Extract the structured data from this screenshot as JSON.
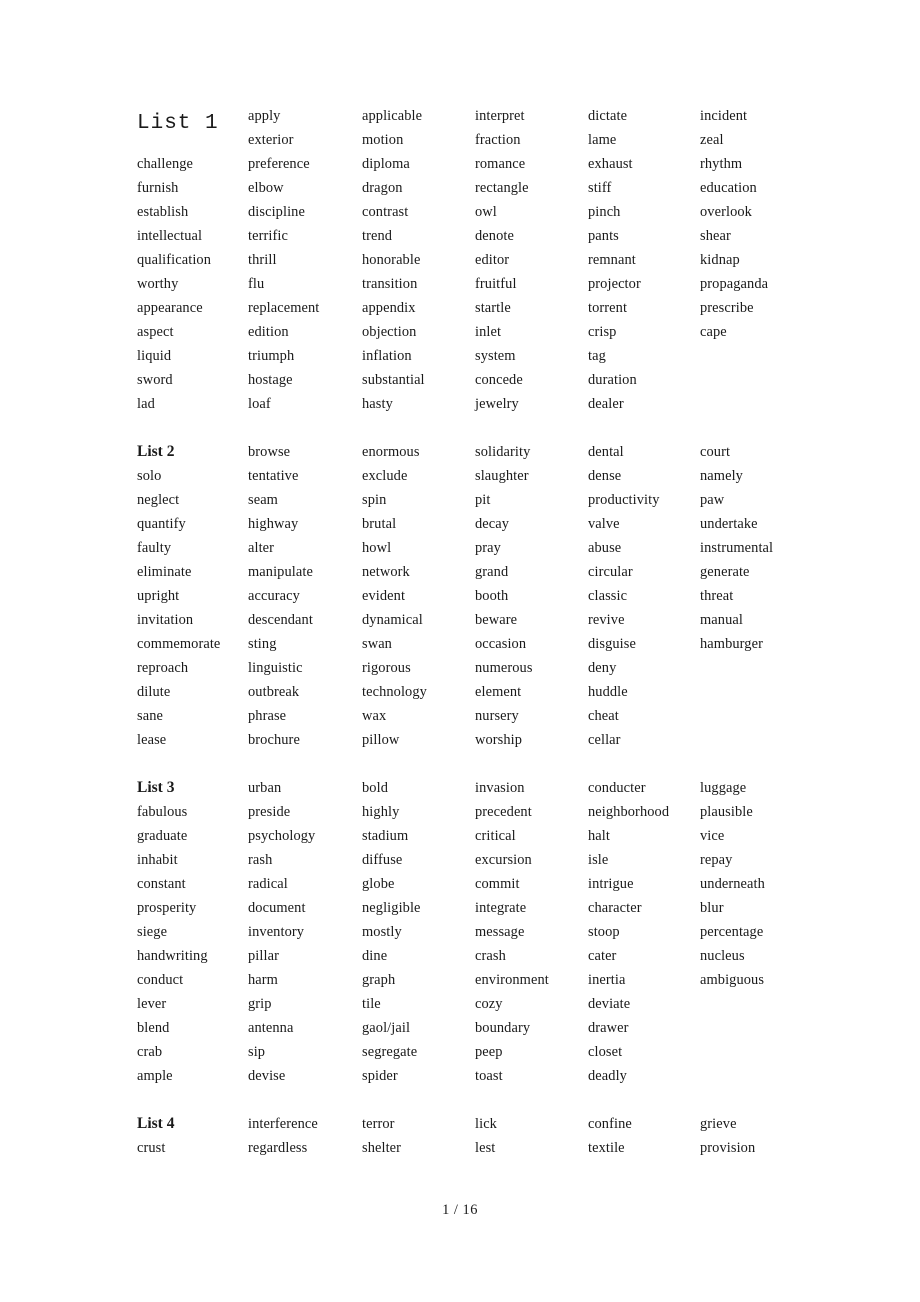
{
  "document": {
    "footer": {
      "page_number": "1",
      "separator": "/",
      "total_pages": "16",
      "text": "1  / 16"
    }
  },
  "lists": [
    {
      "title": "List 1",
      "title_style": "mono",
      "columns": [
        [
          "challenge",
          "furnish",
          "establish",
          "intellectual",
          "qualification",
          "worthy",
          "appearance",
          "aspect",
          "liquid",
          "sword",
          "lad"
        ],
        [
          "apply",
          "exterior",
          "preference",
          "elbow",
          "discipline",
          "terrific",
          "thrill",
          "flu",
          "replacement",
          "edition",
          "triumph",
          "hostage",
          "loaf"
        ],
        [
          "applicable",
          "motion",
          "diploma",
          "dragon",
          "contrast",
          "trend",
          "honorable",
          "transition",
          "appendix",
          "objection",
          "inflation",
          "substantial",
          "hasty"
        ],
        [
          "interpret",
          "fraction",
          "romance",
          "rectangle",
          "owl",
          "denote",
          "editor",
          "fruitful",
          "startle",
          "inlet",
          "system",
          "concede",
          "jewelry"
        ],
        [
          "dictate",
          "lame",
          "exhaust",
          "stiff",
          "pinch",
          "pants",
          "remnant",
          "projector",
          "torrent",
          "crisp",
          "tag",
          "duration",
          "dealer"
        ],
        [
          "incident",
          "zeal",
          "rhythm",
          "education",
          "overlook",
          "shear",
          "kidnap",
          "propaganda",
          "prescribe",
          "cape"
        ]
      ]
    },
    {
      "title": "List 2",
      "title_style": "bold",
      "columns": [
        [
          "solo",
          "neglect",
          "quantify",
          "faulty",
          "eliminate",
          "upright",
          "invitation",
          "commemorate",
          "reproach",
          "dilute",
          "sane",
          "lease"
        ],
        [
          "browse",
          "tentative",
          "seam",
          "highway",
          "alter",
          "manipulate",
          "accuracy",
          "descendant",
          "sting",
          "linguistic",
          "outbreak",
          "phrase",
          "brochure"
        ],
        [
          "enormous",
          "exclude",
          "spin",
          "brutal",
          "howl",
          "network",
          "evident",
          "dynamical",
          "swan",
          "rigorous",
          "technology",
          "wax",
          "pillow"
        ],
        [
          "solidarity",
          "slaughter",
          "pit",
          "decay",
          "pray",
          "grand",
          "booth",
          "beware",
          "occasion",
          "numerous",
          "element",
          "nursery",
          "worship"
        ],
        [
          "dental",
          "dense",
          "productivity",
          "valve",
          "abuse",
          "circular",
          "classic",
          "revive",
          "disguise",
          "deny",
          "huddle",
          "cheat",
          "cellar"
        ],
        [
          "court",
          "namely",
          "paw",
          "undertake",
          "instrumental",
          "generate",
          "threat",
          "manual",
          "hamburger"
        ]
      ]
    },
    {
      "title": "List 3",
      "title_style": "bold",
      "columns": [
        [
          "fabulous",
          "graduate",
          "inhabit",
          "constant",
          "prosperity",
          "siege",
          "handwriting",
          "conduct",
          "lever",
          "blend",
          "crab",
          "ample"
        ],
        [
          "urban",
          "preside",
          "psychology",
          "rash",
          "radical",
          "document",
          "inventory",
          "pillar",
          "harm",
          "grip",
          "antenna",
          "sip",
          "devise"
        ],
        [
          "bold",
          "highly",
          "stadium",
          "diffuse",
          "globe",
          "negligible",
          "mostly",
          "dine",
          "graph",
          "tile",
          "gaol/jail",
          "segregate",
          "spider"
        ],
        [
          "invasion",
          "precedent",
          "critical",
          "excursion",
          "commit",
          "integrate",
          "message",
          "crash",
          "environment",
          "cozy",
          "boundary",
          "peep",
          "toast"
        ],
        [
          "conducter",
          "neighborhood",
          "halt",
          "isle",
          "intrigue",
          "character",
          "stoop",
          "cater",
          "inertia",
          "deviate",
          "drawer",
          "closet",
          "deadly"
        ],
        [
          "luggage",
          "plausible",
          "vice",
          "repay",
          "underneath",
          "blur",
          "percentage",
          "nucleus",
          "ambiguous"
        ]
      ]
    },
    {
      "title": "List 4",
      "title_style": "bold",
      "columns": [
        [
          "crust"
        ],
        [
          "interference",
          "regardless"
        ],
        [
          "terror",
          "shelter"
        ],
        [
          "lick",
          "lest"
        ],
        [
          "confine",
          "textile"
        ],
        [
          "grieve",
          "provision"
        ]
      ]
    }
  ]
}
